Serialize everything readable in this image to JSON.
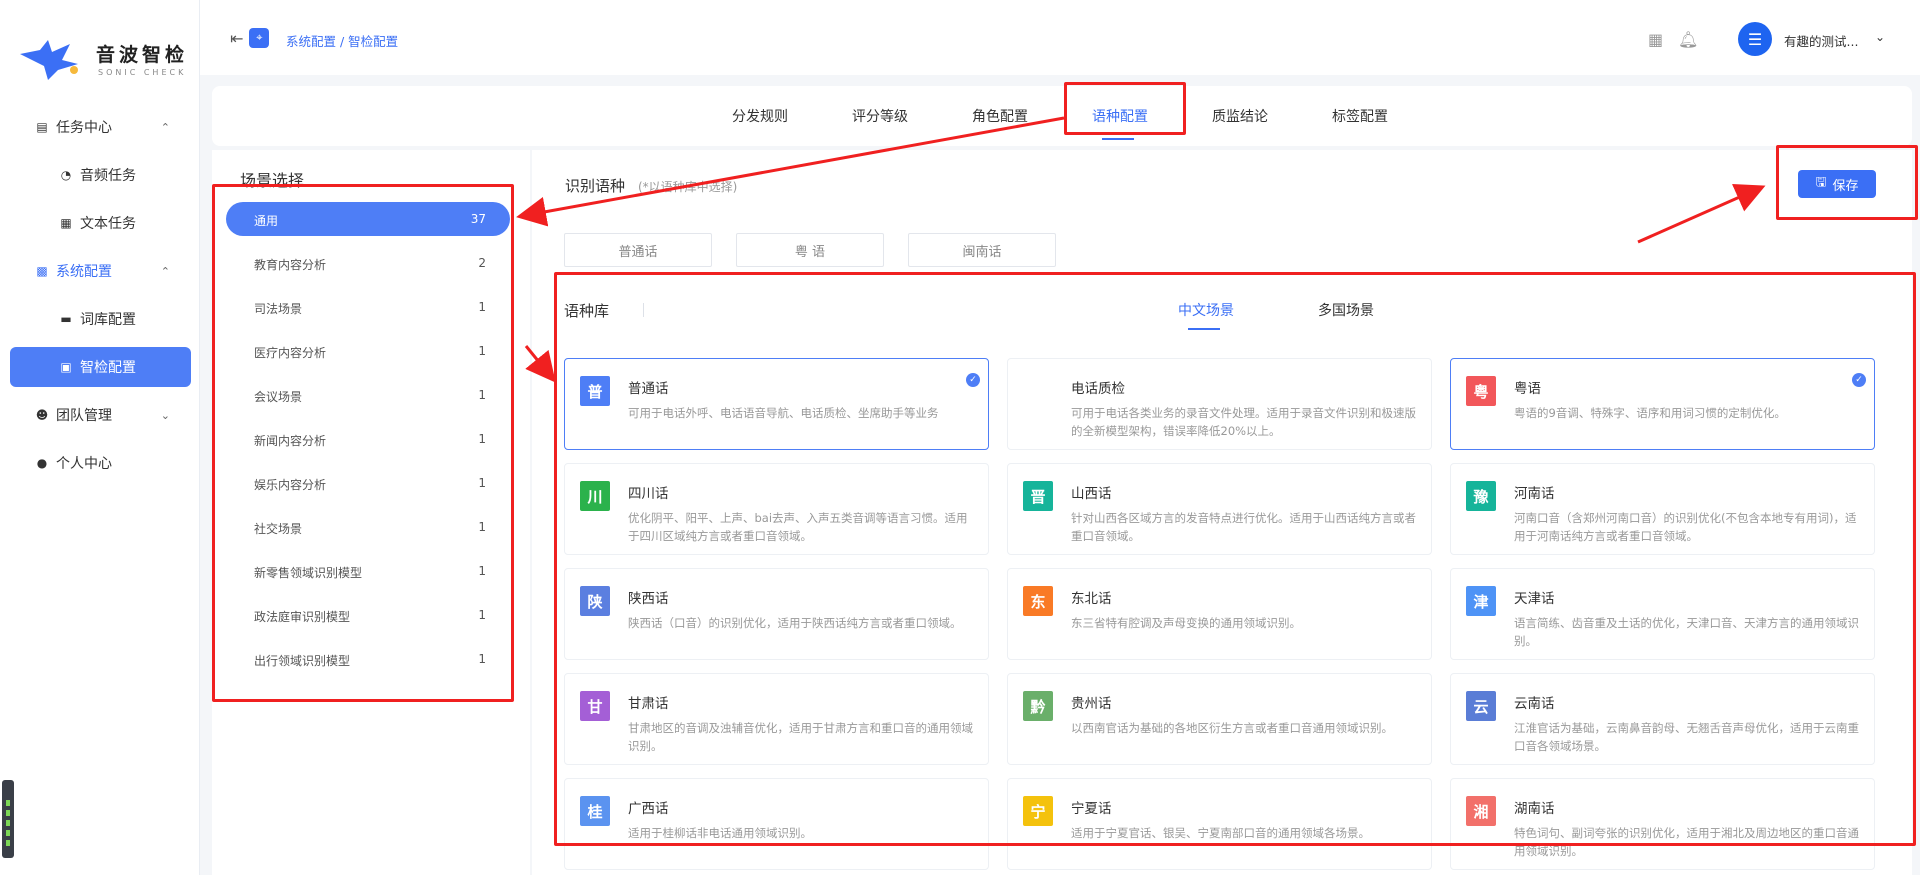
{
  "app": {
    "logo_text": "音波智检",
    "logo_subtitle": "SONIC CHECK"
  },
  "sidebar": {
    "items": [
      {
        "label": "任务中心",
        "icon": "task-center-icon",
        "expanded": true
      },
      {
        "label": "音频任务",
        "icon": "audio-task-icon"
      },
      {
        "label": "文本任务",
        "icon": "text-task-icon"
      },
      {
        "label": "系统配置",
        "icon": "system-config-icon",
        "expanded": true,
        "active": true
      },
      {
        "label": "词库配置",
        "icon": "lexicon-config-icon"
      },
      {
        "label": "智检配置",
        "icon": "smart-check-config-icon",
        "selected": true
      },
      {
        "label": "团队管理",
        "icon": "team-management-icon",
        "expanded": false
      },
      {
        "label": "个人中心",
        "icon": "personal-center-icon"
      }
    ]
  },
  "header": {
    "breadcrumb": "系统配置 / 智检配置",
    "username": "有趣的测试..."
  },
  "main_tabs": [
    {
      "label": "分发规则"
    },
    {
      "label": "评分等级"
    },
    {
      "label": "角色配置"
    },
    {
      "label": "语种配置",
      "active": true
    },
    {
      "label": "质监结论"
    },
    {
      "label": "标签配置"
    }
  ],
  "scene": {
    "title": "场景选择",
    "items": [
      {
        "label": "通用",
        "count": "37",
        "active": true
      },
      {
        "label": "教育内容分析",
        "count": "2"
      },
      {
        "label": "司法场景",
        "count": "1"
      },
      {
        "label": "医疗内容分析",
        "count": "1"
      },
      {
        "label": "会议场景",
        "count": "1"
      },
      {
        "label": "新闻内容分析",
        "count": "1"
      },
      {
        "label": "娱乐内容分析",
        "count": "1"
      },
      {
        "label": "社交场景",
        "count": "1"
      },
      {
        "label": "新零售领域识别模型",
        "count": "1"
      },
      {
        "label": "政法庭审识别模型",
        "count": "1"
      },
      {
        "label": "出行领域识别模型",
        "count": "1"
      }
    ]
  },
  "recognition": {
    "title": "识别语种",
    "hint": "(*以语种库中选择)",
    "save_label": "保存",
    "selected_chips": [
      "普通话",
      "粤 语",
      "闽南话"
    ]
  },
  "library": {
    "title": "语种库",
    "tabs": [
      {
        "label": "中文场景",
        "active": true
      },
      {
        "label": "多国场景"
      }
    ],
    "cards": [
      {
        "badge": "普",
        "color": "#4e7ef6",
        "name": "普通话",
        "desc": "可用于电话外呼、电话语音导航、电话质检、坐席助手等业务",
        "selected": true
      },
      {
        "badge": "",
        "color": "",
        "name": "电话质检",
        "desc": "可用于电话各类业务的录音文件处理。适用于录音文件识别和极速版的全新模型架构，错误率降低20%以上。",
        "selected": false
      },
      {
        "badge": "粤",
        "color": "#f2575a",
        "name": "粤语",
        "desc": "粤语的9音调、特殊字、语序和用词习惯的定制优化。",
        "selected": true
      },
      {
        "badge": "川",
        "color": "#2bb24c",
        "name": "四川话",
        "desc": "优化阴平、阳平、上声、bai去声、入声五类音调等语言习惯。适用于四川区域纯方言或者重口音领域。",
        "selected": false
      },
      {
        "badge": "晋",
        "color": "#16b49a",
        "name": "山西话",
        "desc": "针对山西各区域方言的发音特点进行优化。适用于山西话纯方言或者重口音领域。",
        "selected": false
      },
      {
        "badge": "豫",
        "color": "#16b49a",
        "name": "河南话",
        "desc": "河南口音（含郑州河南口音）的识别优化(不包含本地专有用词)，适用于河南话纯方言或者重口音领域。",
        "selected": false
      },
      {
        "badge": "陕",
        "color": "#5b7fe0",
        "name": "陕西话",
        "desc": "陕西话（口音）的识别优化，适用于陕西话纯方言或者重口领域。",
        "selected": false
      },
      {
        "badge": "东",
        "color": "#f97a26",
        "name": "东北话",
        "desc": "东三省特有腔调及声母变换的通用领域识别。",
        "selected": false
      },
      {
        "badge": "津",
        "color": "#4e93f6",
        "name": "天津话",
        "desc": "语言简练、齿音重及土话的优化，天津口音、天津方言的通用领域识别。",
        "selected": false
      },
      {
        "badge": "甘",
        "color": "#a45fd6",
        "name": "甘肃话",
        "desc": "甘肃地区的音调及浊辅音优化，适用于甘肃方言和重口音的通用领域识别。",
        "selected": false
      },
      {
        "badge": "黔",
        "color": "#6aaf6a",
        "name": "贵州话",
        "desc": "以西南官话为基础的各地区衍生方言或者重口音通用领域识别。",
        "selected": false
      },
      {
        "badge": "云",
        "color": "#5a7dd6",
        "name": "云南话",
        "desc": "江淮官话为基础，云南鼻音韵母、无翘舌音声母优化，适用于云南重口音各领域场景。",
        "selected": false
      },
      {
        "badge": "桂",
        "color": "#5b93f0",
        "name": "广西话",
        "desc": "适用于桂柳话非电话通用领域识别。",
        "selected": false
      },
      {
        "badge": "宁",
        "color": "#f4c20d",
        "name": "宁夏话",
        "desc": "适用于宁夏官话、银吴、宁夏南部口音的通用领域各场景。",
        "selected": false
      },
      {
        "badge": "湘",
        "color": "#f2706a",
        "name": "湖南话",
        "desc": "特色词句、副词夸张的识别优化，适用于湘北及周边地区的重口音通用领域识别。",
        "selected": false
      }
    ]
  },
  "colors": {
    "accent": "#3b6ff5",
    "annotation": "#f02020"
  }
}
